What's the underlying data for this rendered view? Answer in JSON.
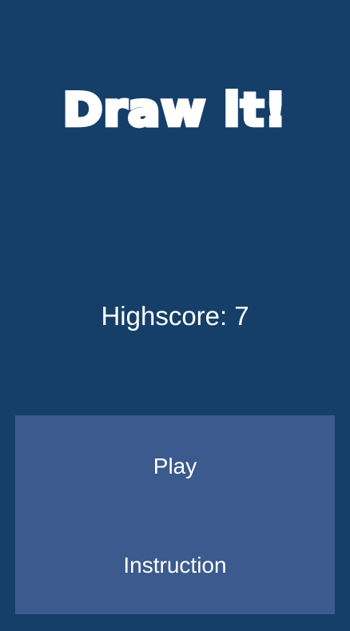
{
  "app": {
    "title": "Draw it!"
  },
  "highscore": {
    "label": "Highscore:",
    "value": "7"
  },
  "menu": {
    "play_label": "Play",
    "instruction_label": "Instruction"
  },
  "colors": {
    "background": "#153f69",
    "panel": "#3b5a8d",
    "text": "#ffffff"
  }
}
